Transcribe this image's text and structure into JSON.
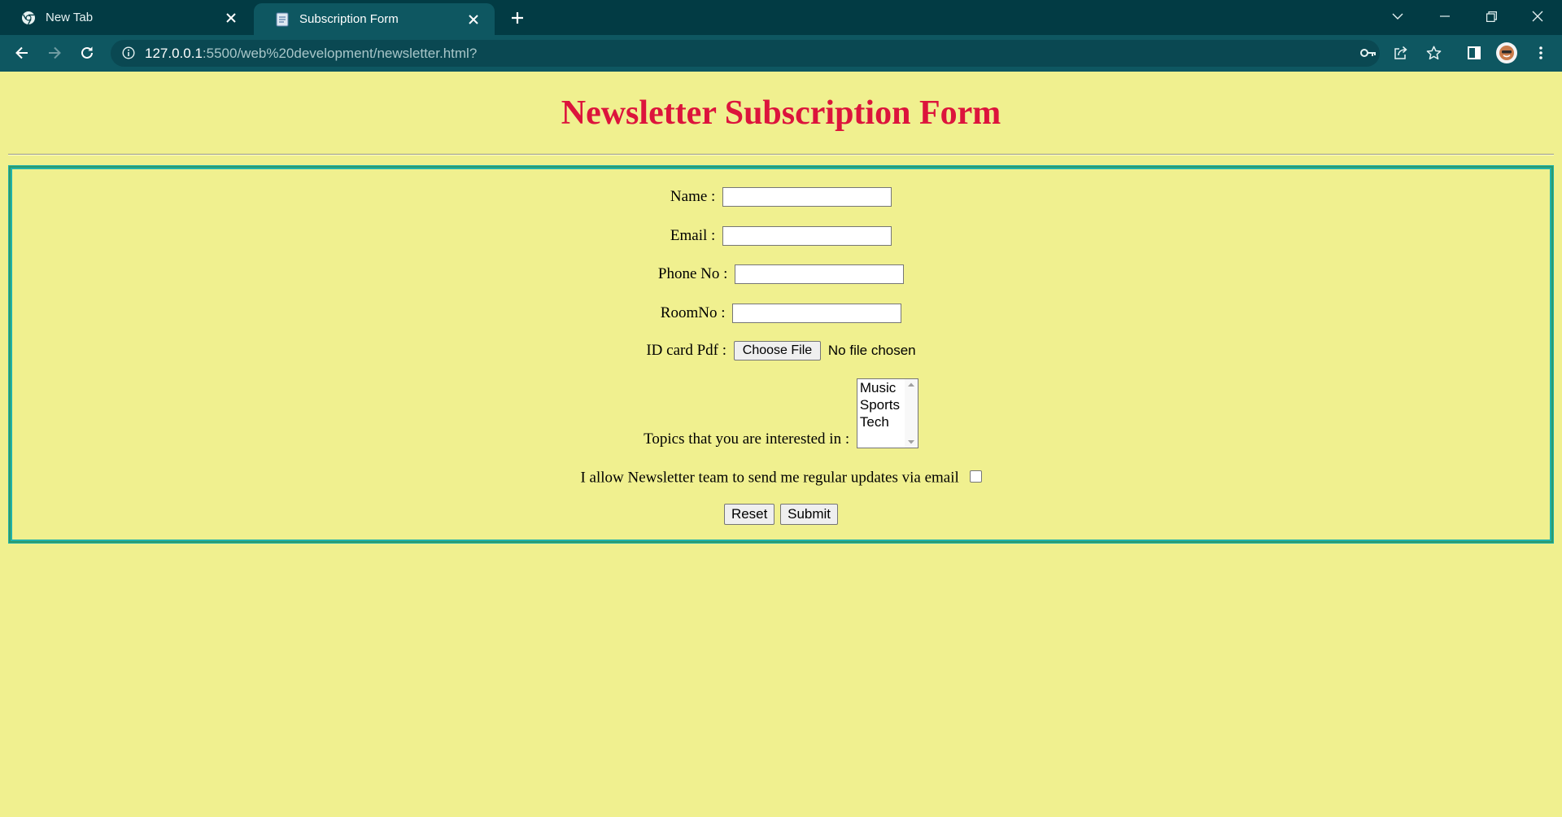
{
  "browser": {
    "tabs": [
      {
        "title": "New Tab",
        "icon": "chrome-icon",
        "active": false
      },
      {
        "title": "Subscription Form",
        "icon": "document-icon",
        "active": true
      }
    ],
    "url_host": "127.0.0.1",
    "url_rest": ":5500/web%20development/newsletter.html?"
  },
  "page": {
    "title": "Newsletter Subscription Form",
    "title_color": "#dc143c",
    "background": "#f0f08f",
    "border_color": "#20b2aa",
    "form": {
      "name_label": "Name :",
      "email_label": "Email :",
      "phone_label": "Phone No :",
      "room_label": "RoomNo :",
      "idcard_label": "ID card Pdf :",
      "file_button": "Choose File",
      "file_status": "No file chosen",
      "topics_label": "Topics that you are interested in :",
      "topics": [
        "Music",
        "Sports",
        "Tech"
      ],
      "consent_label": "I allow Newsletter team to send me regular updates via email",
      "reset_button": "Reset",
      "submit_button": "Submit"
    }
  }
}
